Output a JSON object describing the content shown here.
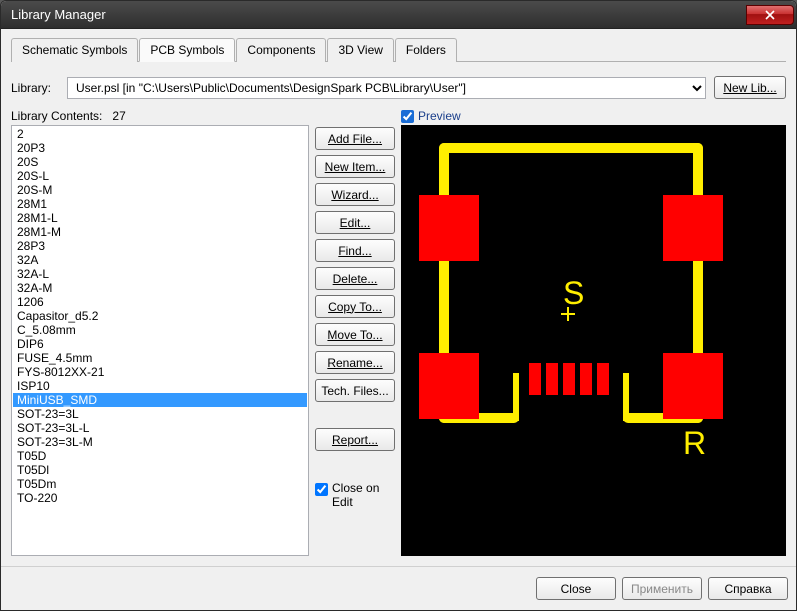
{
  "window": {
    "title": "Library Manager"
  },
  "tabs": {
    "items": [
      {
        "label": "Schematic Symbols"
      },
      {
        "label": "PCB Symbols"
      },
      {
        "label": "Components"
      },
      {
        "label": "3D View"
      },
      {
        "label": "Folders"
      }
    ],
    "active": 1
  },
  "library": {
    "label": "Library:",
    "value": "User.psl   [in \"C:\\Users\\Public\\Documents\\DesignSpark PCB\\Library\\User\"]",
    "new_lib": "New Lib..."
  },
  "contents": {
    "label": "Library Contents:",
    "count": "27",
    "items": [
      "2",
      "20P3",
      "20S",
      "20S-L",
      "20S-M",
      "28M1",
      "28M1-L",
      "28M1-M",
      "28P3",
      "32A",
      "32A-L",
      "32A-M",
      "1206",
      "Capasitor_d5.2",
      "C_5.08mm",
      "DIP6",
      "FUSE_4.5mm",
      "FYS-8012XX-21",
      "ISP10",
      "MiniUSB_SMD",
      "SOT-23=3L",
      "SOT-23=3L-L",
      "SOT-23=3L-M",
      "T05D",
      "T05Dl",
      "T05Dm",
      "TO-220"
    ],
    "selected": 19
  },
  "actions": {
    "add_file": "Add File...",
    "new_item": "New Item...",
    "wizard": "Wizard...",
    "edit": "Edit...",
    "find": "Find...",
    "delete": "Delete...",
    "copy_to": "Copy To...",
    "move_to": "Move To...",
    "rename": "Rename...",
    "tech_files": "Tech. Files...",
    "report": "Report...",
    "close_on_edit": "Close on Edit"
  },
  "preview": {
    "label": "Preview",
    "checked": true,
    "symbol_s": "S",
    "symbol_r": "R"
  },
  "footer": {
    "close": "Close",
    "apply": "Применить",
    "help": "Справка"
  }
}
